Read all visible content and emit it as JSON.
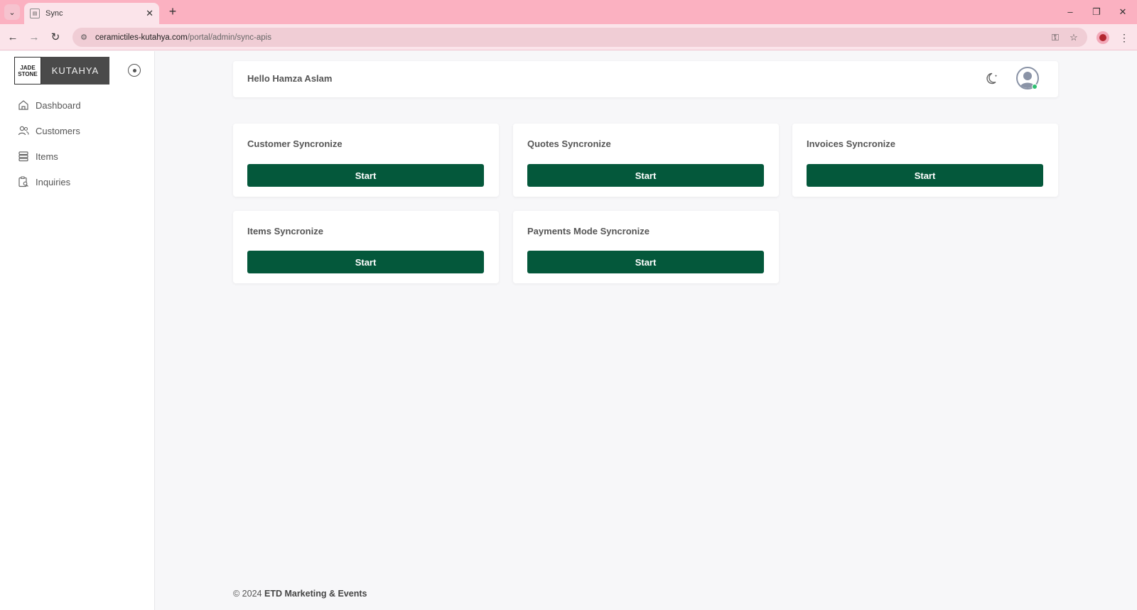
{
  "browser": {
    "tab_title": "Sync",
    "tab_close": "✕",
    "new_tab": "+",
    "url_host": "ceramictiles-kutahya.com",
    "url_path": "/portal/admin/sync-apis",
    "minimize": "–",
    "restore": "❐",
    "close": "✕",
    "back": "←",
    "forward": "→",
    "reload": "↻",
    "more": "⋮"
  },
  "sidebar": {
    "logo_left_line1": "JADE",
    "logo_left_line2": "STONE",
    "logo_right": "KUTAHYA",
    "items": [
      {
        "label": "Dashboard",
        "icon": "home-icon"
      },
      {
        "label": "Customers",
        "icon": "users-icon"
      },
      {
        "label": "Items",
        "icon": "stack-icon"
      },
      {
        "label": "Inquiries",
        "icon": "clipboard-search-icon"
      }
    ]
  },
  "header": {
    "greeting": "Hello Hamza Aslam"
  },
  "cards": [
    {
      "title": "Customer Syncronize",
      "button": "Start"
    },
    {
      "title": "Quotes Syncronize",
      "button": "Start"
    },
    {
      "title": "Invoices Syncronize",
      "button": "Start"
    },
    {
      "title": "Items Syncronize",
      "button": "Start"
    },
    {
      "title": "Payments Mode Syncronize",
      "button": "Start"
    }
  ],
  "footer": {
    "prefix": "© 2024",
    "company": "ETD Marketing & Events"
  },
  "colors": {
    "accent": "#04583b",
    "browser_frame": "#fbb1c1",
    "online_status": "#2fbf71"
  }
}
